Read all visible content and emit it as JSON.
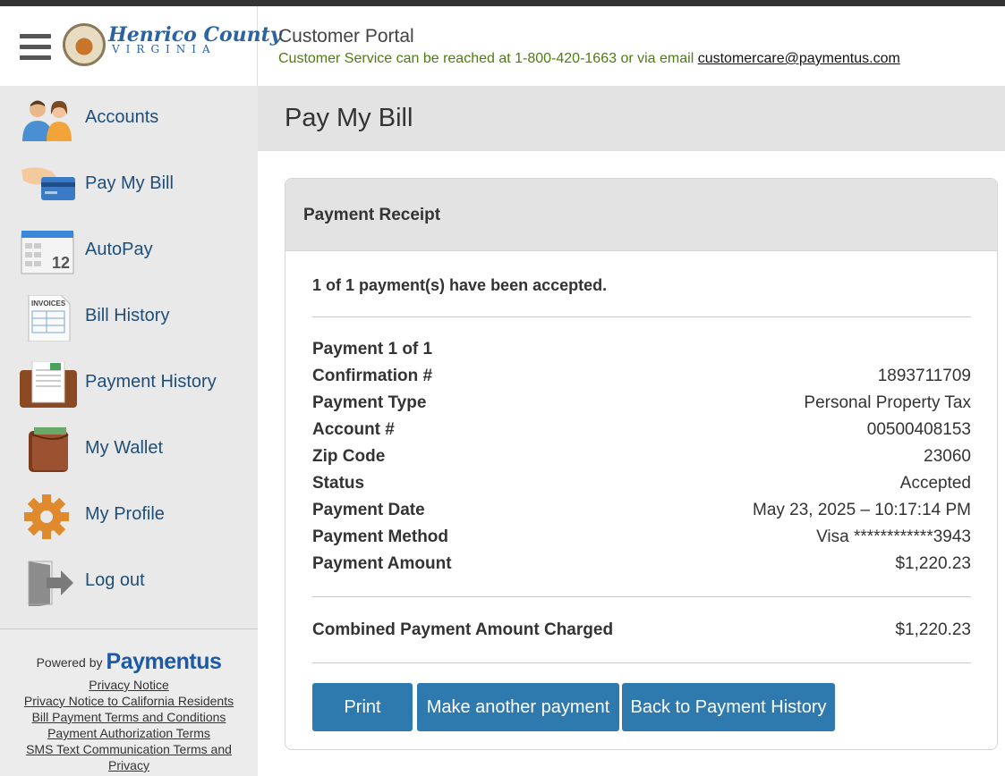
{
  "header": {
    "logo_main": "Henrico County",
    "logo_sub": "VIRGINIA",
    "portal_title": "Customer Portal",
    "service_text": "Customer Service can be reached at 1-800-420-1663 or via email ",
    "service_email": "customercare@paymentus.com"
  },
  "sidebar": {
    "items": [
      {
        "label": "Accounts",
        "icon": "accounts-icon"
      },
      {
        "label": "Pay My Bill",
        "icon": "credit-card-hand-icon"
      },
      {
        "label": "AutoPay",
        "icon": "calendar-icon"
      },
      {
        "label": "Bill History",
        "icon": "invoices-icon"
      },
      {
        "label": "Payment History",
        "icon": "wallet-receipt-icon"
      },
      {
        "label": "My Wallet",
        "icon": "wallet-icon"
      },
      {
        "label": "My Profile",
        "icon": "gear-icon"
      },
      {
        "label": "Log out",
        "icon": "logout-door-icon"
      }
    ],
    "powered_by": "Powered by",
    "brand": "Paymentus",
    "legal_links": [
      "Privacy Notice",
      "Privacy Notice to California Residents",
      "Bill Payment Terms and Conditions",
      "Payment Authorization Terms",
      "SMS Text Communication Terms and",
      "Privacy"
    ]
  },
  "page": {
    "title": "Pay My Bill"
  },
  "receipt": {
    "title": "Payment Receipt",
    "accepted_text": "1 of 1 payment(s) have been accepted.",
    "payment_heading": "Payment 1 of 1",
    "rows": [
      {
        "label": "Confirmation #",
        "value": "1893711709"
      },
      {
        "label": "Payment Type",
        "value": "Personal Property Tax"
      },
      {
        "label": "Account #",
        "value": "00500408153"
      },
      {
        "label": "Zip Code",
        "value": "23060"
      },
      {
        "label": "Status",
        "value": "Accepted"
      },
      {
        "label": "Payment Date",
        "value": "May 23, 2025 – 10:17:14 PM"
      },
      {
        "label": "Payment Method",
        "value": "Visa ************3943"
      },
      {
        "label": "Payment Amount",
        "value": "$1,220.23"
      }
    ],
    "combined_label": "Combined Payment Amount Charged",
    "combined_value": "$1,220.23",
    "buttons": {
      "print": "Print",
      "another": "Make another payment",
      "history": "Back to Payment History"
    }
  },
  "colors": {
    "accent": "#2e79ad",
    "nav_text": "#1f4e79",
    "service_green": "#4d7c0f"
  }
}
